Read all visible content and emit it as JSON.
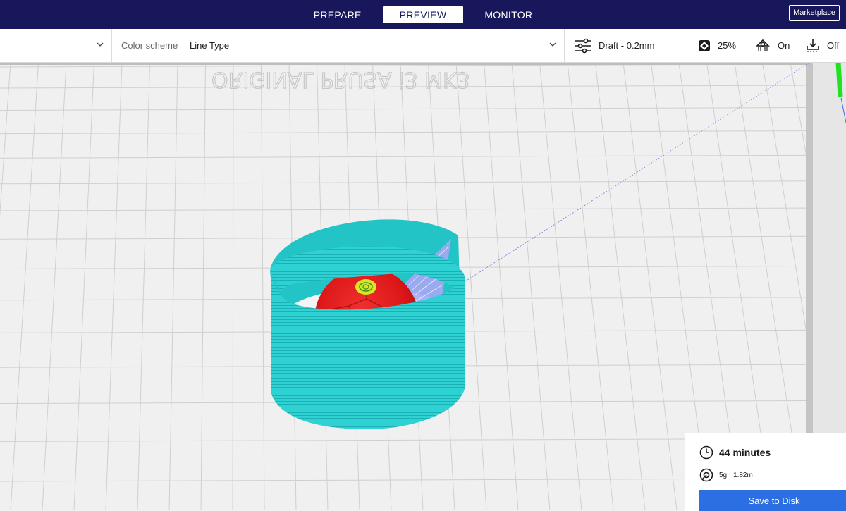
{
  "stages": [
    {
      "label": "PREPARE",
      "active": false
    },
    {
      "label": "PREVIEW",
      "active": true
    },
    {
      "label": "MONITOR",
      "active": false
    }
  ],
  "marketplace_label": "Marketplace",
  "settings_bar": {
    "color_scheme_label": "Color scheme",
    "color_scheme_value": "Line Type",
    "profile": "Draft - 0.2mm",
    "infill": "25%",
    "support": "On",
    "adhesion": "Off"
  },
  "viewport": {
    "bed_logo_text": "ORIGINAL PRUSA i3 MK3",
    "colors": {
      "skirt": "#2fd2d2",
      "model": "#e01e1e",
      "support": "#a7a7f5",
      "top_skin": "#d9e624",
      "travel": "#6f7bd8",
      "axis_y": "#22e022"
    }
  },
  "print_info": {
    "time": "44 minutes",
    "material": "5g · 1.82m",
    "save_label": "Save to Disk"
  },
  "icons": {
    "chevron": "chevron-down-icon",
    "profile": "sliders-icon",
    "infill": "infill-icon",
    "support": "support-icon",
    "adhesion": "adhesion-icon",
    "time": "clock-icon",
    "material": "spool-icon"
  }
}
